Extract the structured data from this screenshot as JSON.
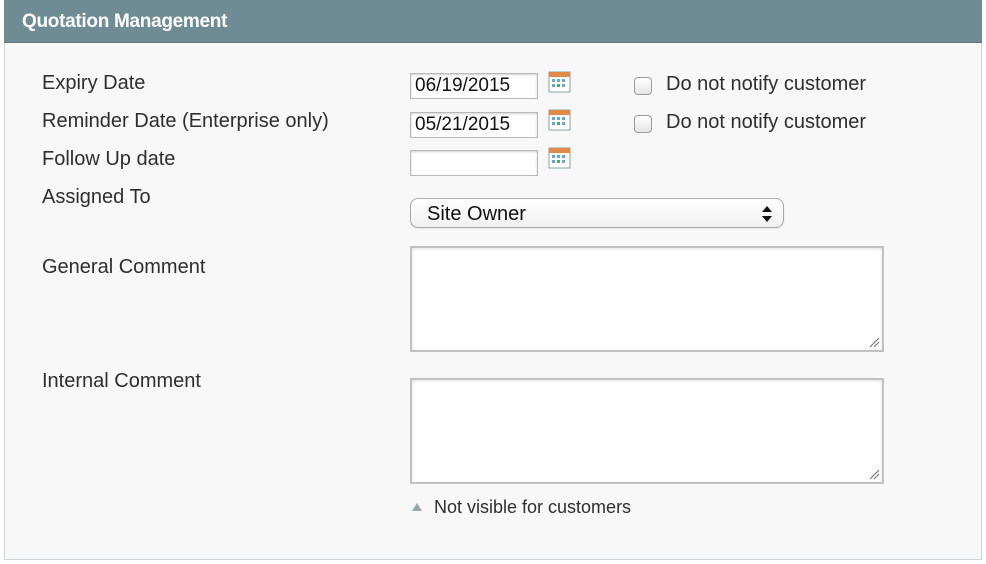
{
  "panel": {
    "title": "Quotation Management"
  },
  "fields": {
    "expiry": {
      "label": "Expiry Date",
      "value": "06/19/2015",
      "notify_label": "Do not notify customer",
      "notify_checked": false
    },
    "reminder": {
      "label": "Reminder Date (Enterprise only)",
      "value": "05/21/2015",
      "notify_label": "Do not notify customer",
      "notify_checked": false
    },
    "follow_up": {
      "label": "Follow Up date",
      "value": ""
    },
    "assigned_to": {
      "label": "Assigned To",
      "selected": "Site Owner"
    },
    "general_comment": {
      "label": "General Comment",
      "value": ""
    },
    "internal_comment": {
      "label": "Internal Comment",
      "value": "",
      "note": "Not visible for customers"
    }
  },
  "icons": {
    "calendar": "calendar-icon",
    "select_arrows": "up-down-arrows-icon",
    "note": "triangle-up-icon",
    "grip": "resize-grip-icon"
  },
  "colors": {
    "header_bg": "#6f8b94",
    "panel_bg": "#f8f8f8"
  }
}
